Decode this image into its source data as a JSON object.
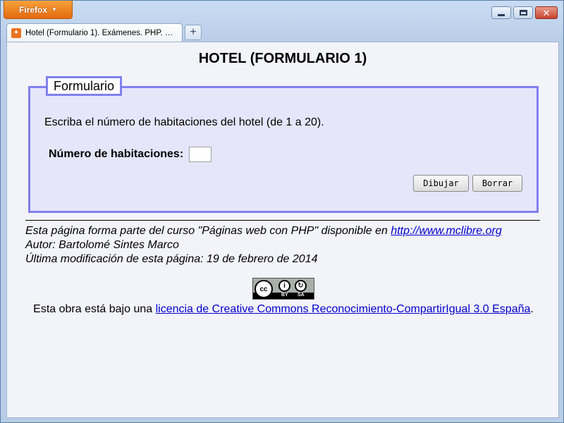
{
  "browser": {
    "menu_label": "Firefox",
    "tab_title": "Hotel (Formulario 1). Exámenes. PHP. Ba...",
    "new_tab_glyph": "+",
    "accent_color": "#e46a10"
  },
  "page": {
    "title": "HOTEL (FORMULARIO 1)",
    "form": {
      "legend": "Formulario",
      "instructions": "Escriba el número de habitaciones del hotel (de 1 a 20).",
      "rooms_label": "Número de habitaciones:",
      "rooms_value": "",
      "draw_button": "Dibujar",
      "reset_button": "Borrar",
      "border_color": "#8080f0",
      "background_color": "#e6e6fb"
    },
    "footer": {
      "course_text": "Esta página forma parte del curso \"Páginas web con PHP\" disponible en ",
      "course_link": "http://www.mclibre.org",
      "author": "Autor: Bartolomé Sintes Marco",
      "last_modified": "Última modificación de esta página: 19 de febrero de 2014"
    },
    "license": {
      "badge_by": "BY",
      "badge_sa": "SA",
      "text_before": "Esta obra está bajo una ",
      "link_text": "licencia de Creative Commons Reconocimiento-CompartirIgual 3.0 España",
      "text_after": ".",
      "link_color": "#0000cc"
    }
  }
}
